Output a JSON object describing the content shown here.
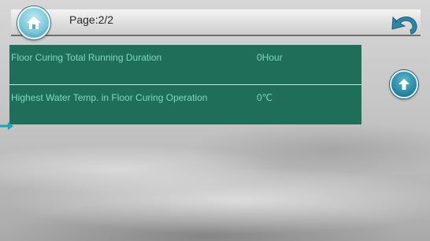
{
  "header": {
    "page_label": "Page:2/2",
    "home_icon": "home-icon",
    "back_icon": "undo-arrow-icon"
  },
  "info": {
    "rows": [
      {
        "label": "Floor Curing Total Running Duration",
        "value": "0Hour"
      },
      {
        "label": "Highest Water Temp. in Floor Curing Operation",
        "value": "0℃"
      }
    ]
  },
  "nav": {
    "up_icon": "arrow-up-icon",
    "pointer_icon": "arrow-right-icon"
  },
  "colors": {
    "panel": "#1f6e5a",
    "panel_text": "#7fd8bf",
    "button": "#2a8aa5"
  }
}
